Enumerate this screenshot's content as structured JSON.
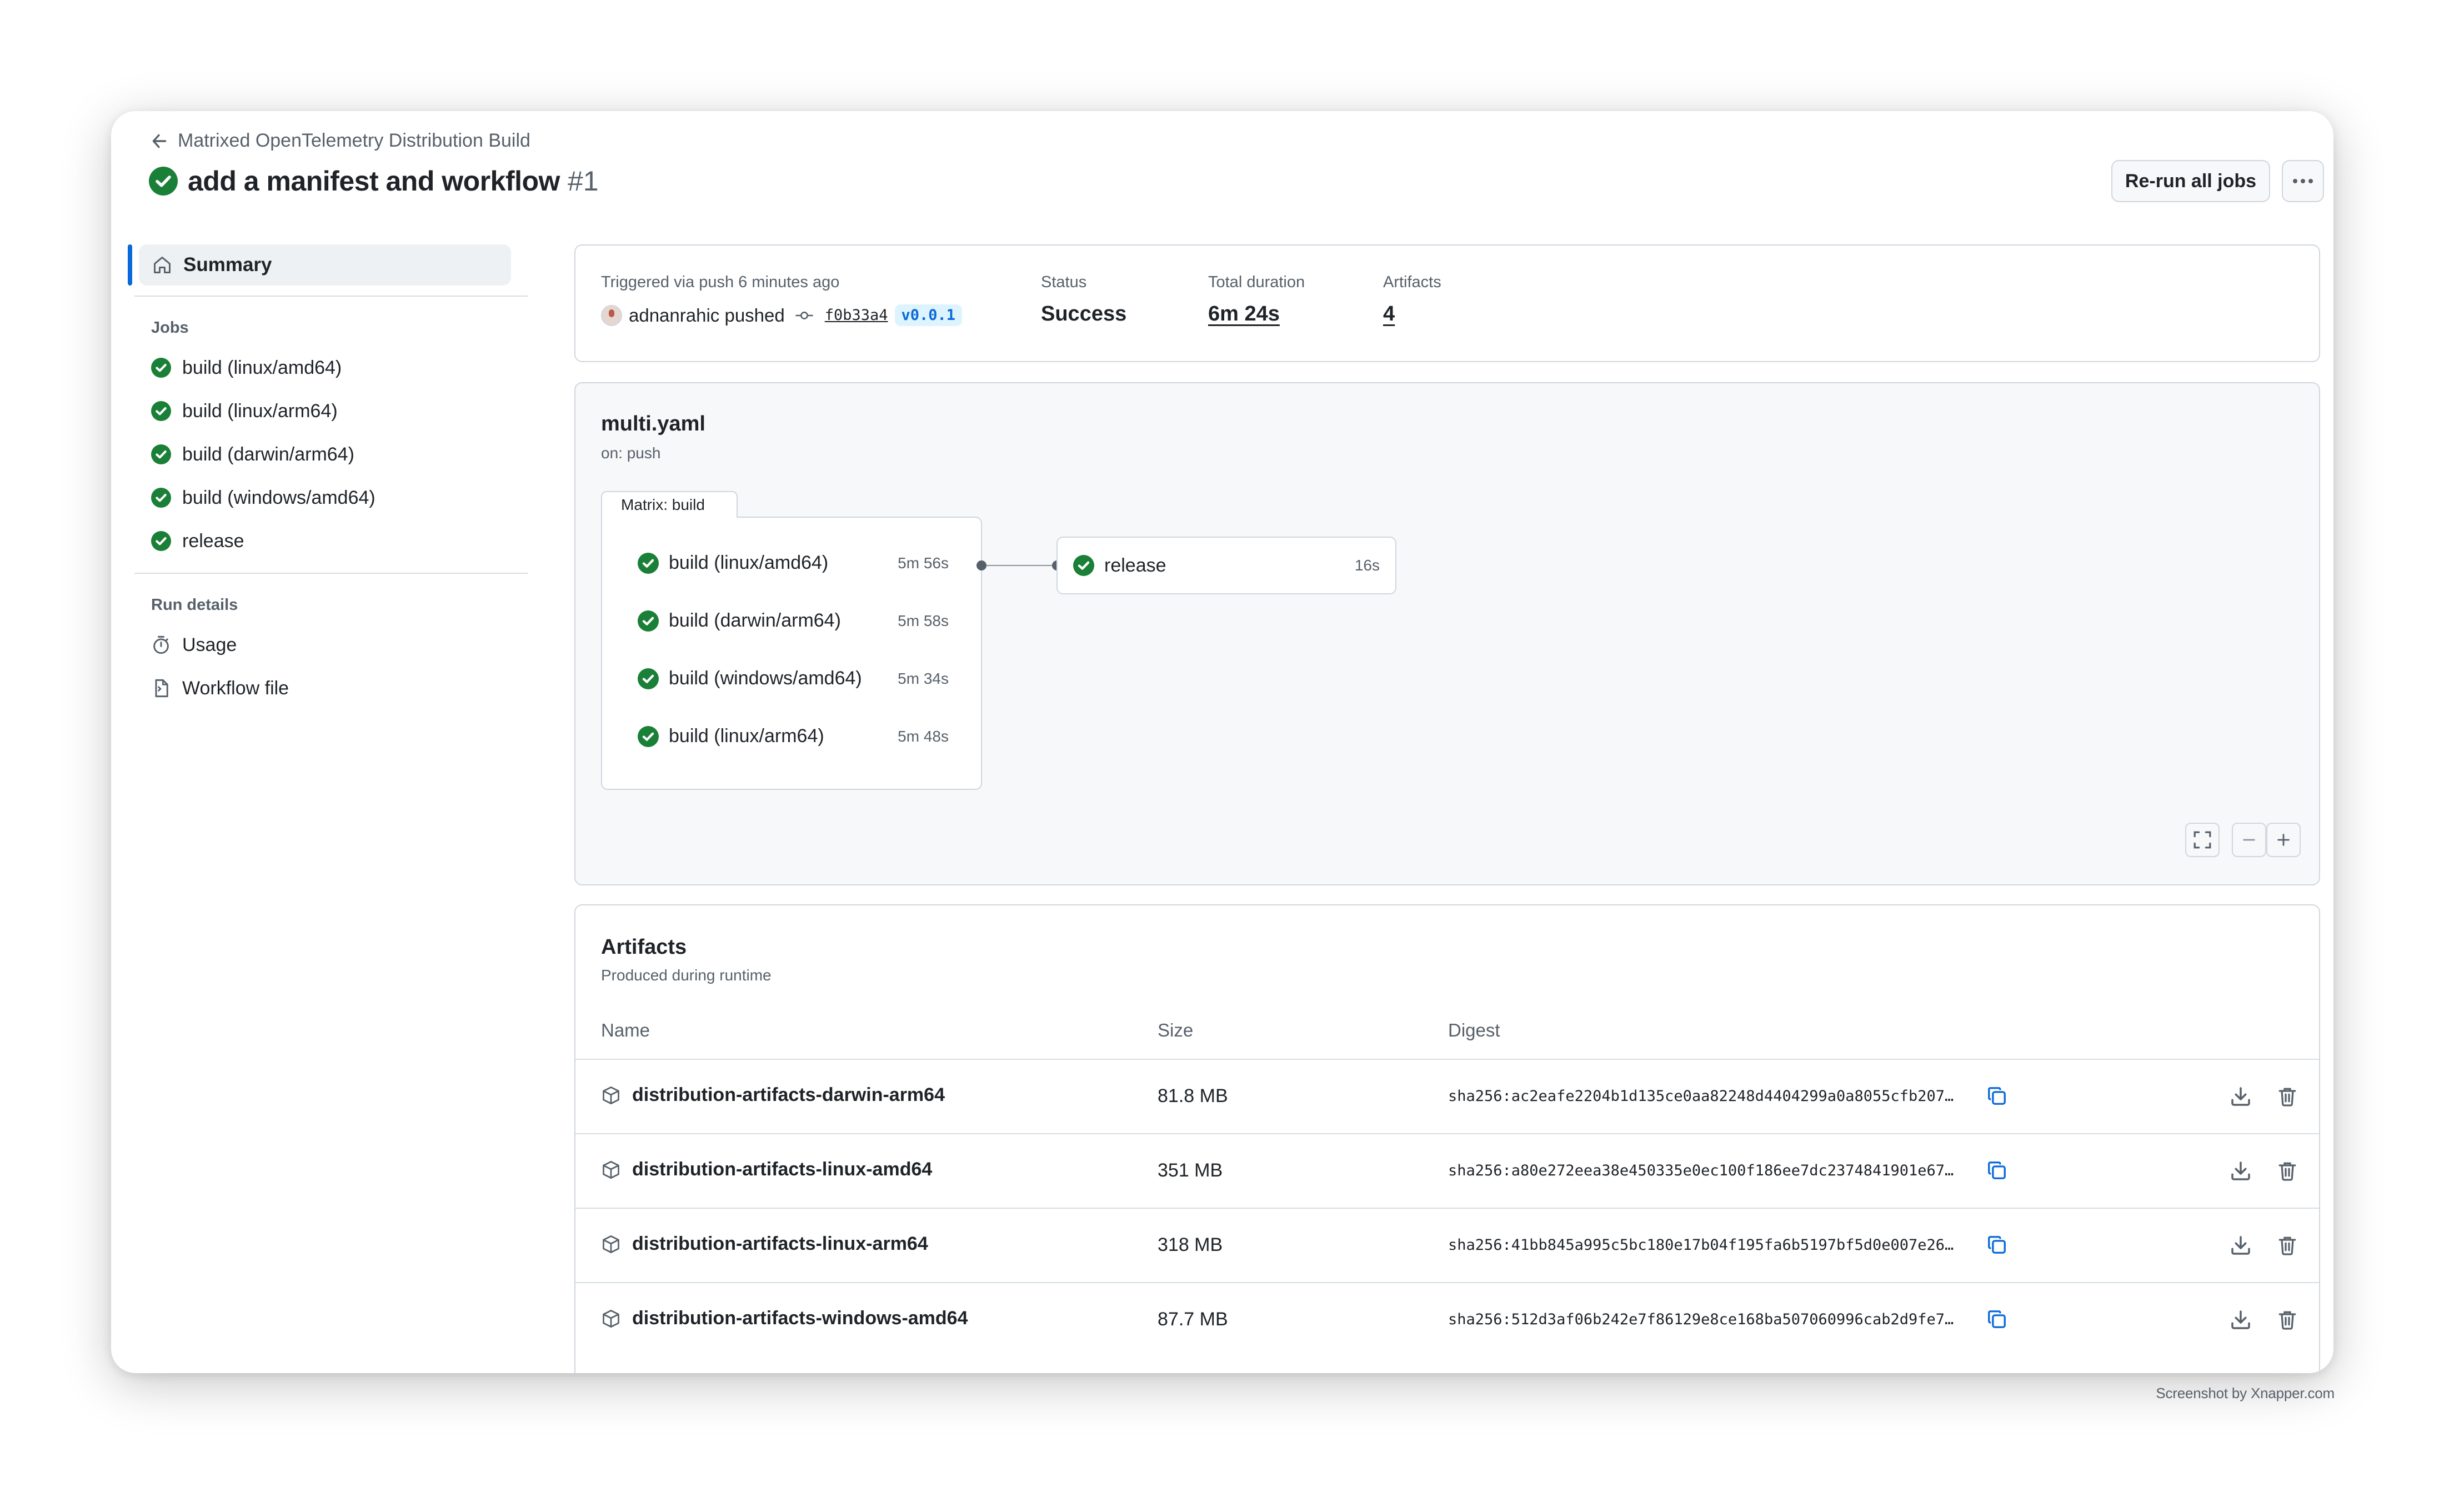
{
  "header": {
    "back_label": "Matrixed OpenTelemetry Distribution Build",
    "title": "add a manifest and workflow",
    "run_number": "#1",
    "rerun_label": "Re-run all jobs"
  },
  "sidebar": {
    "summary_label": "Summary",
    "jobs_heading": "Jobs",
    "jobs": [
      {
        "label": "build (linux/amd64)"
      },
      {
        "label": "build (linux/arm64)"
      },
      {
        "label": "build (darwin/arm64)"
      },
      {
        "label": "build (windows/amd64)"
      },
      {
        "label": "release"
      }
    ],
    "run_details_heading": "Run details",
    "run_details": [
      {
        "label": "Usage",
        "icon": "stopwatch-icon"
      },
      {
        "label": "Workflow file",
        "icon": "file-icon"
      }
    ]
  },
  "summary": {
    "trigger_text": "Triggered via push 6 minutes ago",
    "actor": "adnanrahic pushed",
    "commit": "f0b33a4",
    "tag": "v0.0.1",
    "status_label": "Status",
    "status_value": "Success",
    "duration_label": "Total duration",
    "duration_value": "6m 24s",
    "artifacts_label": "Artifacts",
    "artifacts_value": "4"
  },
  "graph": {
    "workflow_name": "multi.yaml",
    "trigger": "on: push",
    "matrix_label": "Matrix: build",
    "matrix_jobs": [
      {
        "name": "build (linux/amd64)",
        "duration": "5m 56s"
      },
      {
        "name": "build (darwin/arm64)",
        "duration": "5m 58s"
      },
      {
        "name": "build (windows/amd64)",
        "duration": "5m 34s"
      },
      {
        "name": "build (linux/arm64)",
        "duration": "5m 48s"
      }
    ],
    "release_job": {
      "name": "release",
      "duration": "16s"
    }
  },
  "artifacts": {
    "title": "Artifacts",
    "subtitle": "Produced during runtime",
    "columns": [
      "Name",
      "Size",
      "Digest"
    ],
    "rows": [
      {
        "name": "distribution-artifacts-darwin-arm64",
        "size": "81.8 MB",
        "digest": "sha256:ac2eafe2204b1d135ce0aa82248d4404299a0a8055cfb207…"
      },
      {
        "name": "distribution-artifacts-linux-amd64",
        "size": "351 MB",
        "digest": "sha256:a80e272eea38e450335e0ec100f186ee7dc2374841901e67…"
      },
      {
        "name": "distribution-artifacts-linux-arm64",
        "size": "318 MB",
        "digest": "sha256:41bb845a995c5bc180e17b04f195fa6b5197bf5d0e007e26…"
      },
      {
        "name": "distribution-artifacts-windows-amd64",
        "size": "87.7 MB",
        "digest": "sha256:512d3af06b242e7f86129e8ce168ba507060996cab2d9fe7…"
      }
    ]
  },
  "credit": "Screenshot by Xnapper.com",
  "colors": {
    "success": "#1a7f37",
    "accent": "#0969da",
    "border": "#d0d7de",
    "muted": "#57606a"
  }
}
